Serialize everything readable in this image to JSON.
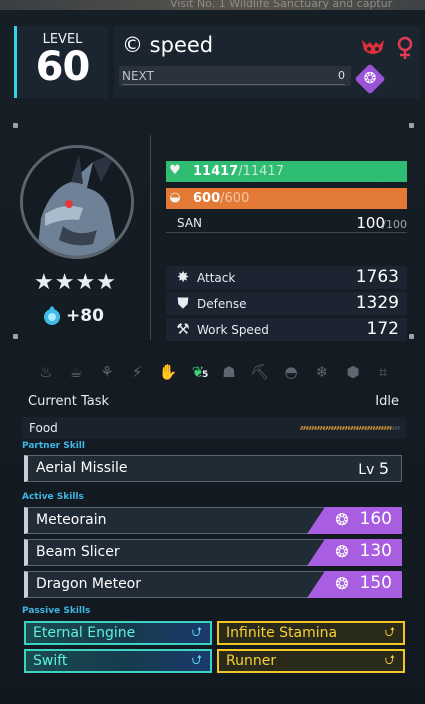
{
  "background": {
    "text": "Visit No. 1 Wildlife Sanctuary and captur"
  },
  "header": {
    "level_label": "LEVEL",
    "level": "60",
    "name": "© speed",
    "element_icon": "dark-demon-icon",
    "gender_icon": "female-icon",
    "next_label": "NEXT",
    "next_value": "0",
    "type_icon": "dragon-element-icon"
  },
  "portrait": {
    "name": "pal-portrait"
  },
  "rarity": {
    "stars": "★★★★",
    "star_count": 4
  },
  "rank": {
    "value": "+80",
    "icon": "soul-icon"
  },
  "stats": {
    "hp": {
      "value": "11417",
      "max": "/11417",
      "icon": "heart-icon"
    },
    "sp": {
      "value": "600",
      "max": "/600",
      "icon": "food-icon"
    },
    "san": {
      "label": "SAN",
      "value": "100",
      "max": "/100"
    }
  },
  "attributes": [
    {
      "label": "Attack",
      "value": "1763",
      "icon": "attack-icon"
    },
    {
      "label": "Defense",
      "value": "1329",
      "icon": "defense-icon"
    },
    {
      "label": "Work Speed",
      "value": "172",
      "icon": "work-speed-icon"
    }
  ],
  "work_suitability": {
    "icons": [
      "kindling-icon",
      "watering-icon",
      "planting-icon",
      "electricity-icon",
      "handiwork-icon",
      "gathering-icon",
      "lumbering-icon",
      "mining-icon",
      "medicine-icon",
      "cooling-icon",
      "transporting-icon",
      "farming-icon"
    ],
    "active_index": 5,
    "active_level": "5"
  },
  "task": {
    "label": "Current Task",
    "value": "Idle"
  },
  "food": {
    "label": "Food",
    "filled": "𝓂𝓂𝓂𝓂𝓂𝓂𝓂𝓂𝓂𝓂𝓂",
    "empty": "𝓂"
  },
  "partner_skill": {
    "title": "Partner Skill",
    "name": "Aerial Missile",
    "lv_label": "Lv",
    "lv": "5"
  },
  "active_skills": {
    "title": "Active Skills",
    "items": [
      {
        "name": "Meteorain",
        "power": "160",
        "icon": "dragon-element-icon"
      },
      {
        "name": "Beam Slicer",
        "power": "130",
        "icon": "dragon-element-icon"
      },
      {
        "name": "Dragon Meteor",
        "power": "150",
        "icon": "dragon-element-icon"
      }
    ]
  },
  "passive_skills": {
    "title": "Passive Skills",
    "items": [
      {
        "name": "Eternal Engine",
        "tier": "cyan",
        "icon": "rank-up-icon"
      },
      {
        "name": "Infinite Stamina",
        "tier": "gold",
        "icon": "rank-up-icon"
      },
      {
        "name": "Swift",
        "tier": "cyan",
        "icon": "rank-up-icon"
      },
      {
        "name": "Runner",
        "tier": "gold",
        "icon": "rank-up-icon"
      }
    ]
  },
  "colors": {
    "accent": "#39d0e8",
    "hp": "#2ebd72",
    "sp": "#e27a35",
    "dragon": "#a95ee1",
    "passive_cyan": "#3bd3c3",
    "passive_gold": "#f1c726",
    "section_title": "#3fb6e4"
  }
}
